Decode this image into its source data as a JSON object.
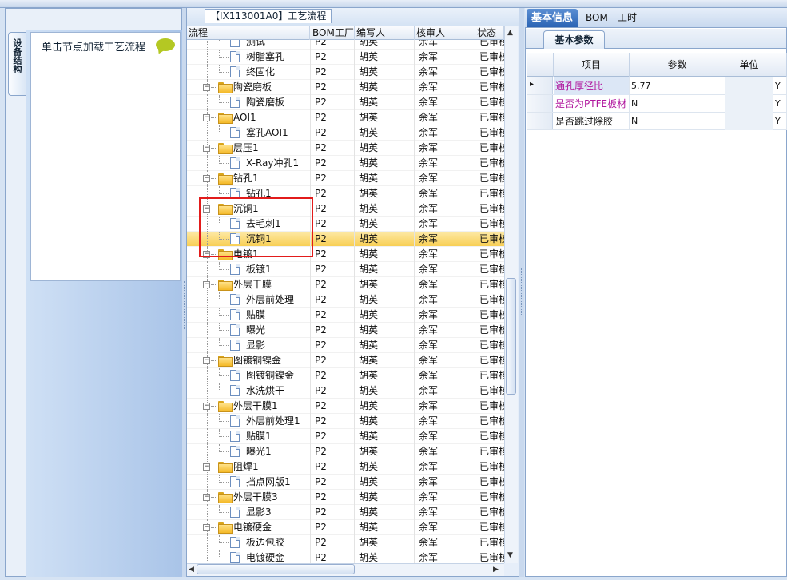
{
  "left_panel": {
    "vertical_tab": "设备结构",
    "hint": "单击节点加载工艺流程"
  },
  "center": {
    "title": "【IX113001A0】工艺流程",
    "columns": [
      "流程",
      "BOM工厂",
      "编写人",
      "核审人",
      "状态"
    ],
    "rows": [
      {
        "name": "测试",
        "type": "doc",
        "level": 2,
        "bom": "P2",
        "writer": "胡英",
        "reviewer": "余军",
        "status": "已审核"
      },
      {
        "name": "树脂塞孔",
        "type": "doc",
        "level": 2,
        "bom": "P2",
        "writer": "胡英",
        "reviewer": "余军",
        "status": "已审核"
      },
      {
        "name": "终固化",
        "type": "doc",
        "level": 2,
        "bom": "P2",
        "writer": "胡英",
        "reviewer": "余军",
        "status": "已审核"
      },
      {
        "name": "陶瓷磨板",
        "type": "folder",
        "level": 1,
        "bom": "P2",
        "writer": "胡英",
        "reviewer": "余军",
        "status": "已审核"
      },
      {
        "name": "陶瓷磨板",
        "type": "doc",
        "level": 2,
        "bom": "P2",
        "writer": "胡英",
        "reviewer": "余军",
        "status": "已审核"
      },
      {
        "name": "AOI1",
        "type": "folder",
        "level": 1,
        "bom": "P2",
        "writer": "胡英",
        "reviewer": "余军",
        "status": "已审核"
      },
      {
        "name": "塞孔AOI1",
        "type": "doc",
        "level": 2,
        "bom": "P2",
        "writer": "胡英",
        "reviewer": "余军",
        "status": "已审核"
      },
      {
        "name": "层压1",
        "type": "folder",
        "level": 1,
        "bom": "P2",
        "writer": "胡英",
        "reviewer": "余军",
        "status": "已审核"
      },
      {
        "name": "X-Ray冲孔1",
        "type": "doc",
        "level": 2,
        "bom": "P2",
        "writer": "胡英",
        "reviewer": "余军",
        "status": "已审核"
      },
      {
        "name": "钻孔1",
        "type": "folder",
        "level": 1,
        "bom": "P2",
        "writer": "胡英",
        "reviewer": "余军",
        "status": "已审核"
      },
      {
        "name": "钻孔1",
        "type": "doc",
        "level": 2,
        "bom": "P2",
        "writer": "胡英",
        "reviewer": "余军",
        "status": "已审核"
      },
      {
        "name": "沉铜1",
        "type": "folder",
        "level": 1,
        "bom": "P2",
        "writer": "胡英",
        "reviewer": "余军",
        "status": "已审核"
      },
      {
        "name": "去毛刺1",
        "type": "doc",
        "level": 2,
        "bom": "P2",
        "writer": "胡英",
        "reviewer": "余军",
        "status": "已审核"
      },
      {
        "name": "沉铜1",
        "type": "doc",
        "level": 2,
        "bom": "P2",
        "writer": "胡英",
        "reviewer": "余军",
        "status": "已审核",
        "selected": true
      },
      {
        "name": "电镀1",
        "type": "folder",
        "level": 1,
        "bom": "P2",
        "writer": "胡英",
        "reviewer": "余军",
        "status": "已审核"
      },
      {
        "name": "板镀1",
        "type": "doc",
        "level": 2,
        "bom": "P2",
        "writer": "胡英",
        "reviewer": "余军",
        "status": "已审核"
      },
      {
        "name": "外层干膜",
        "type": "folder",
        "level": 1,
        "bom": "P2",
        "writer": "胡英",
        "reviewer": "余军",
        "status": "已审核"
      },
      {
        "name": "外层前处理",
        "type": "doc",
        "level": 2,
        "bom": "P2",
        "writer": "胡英",
        "reviewer": "余军",
        "status": "已审核"
      },
      {
        "name": "贴膜",
        "type": "doc",
        "level": 2,
        "bom": "P2",
        "writer": "胡英",
        "reviewer": "余军",
        "status": "已审核"
      },
      {
        "name": "曝光",
        "type": "doc",
        "level": 2,
        "bom": "P2",
        "writer": "胡英",
        "reviewer": "余军",
        "status": "已审核"
      },
      {
        "name": "显影",
        "type": "doc",
        "level": 2,
        "bom": "P2",
        "writer": "胡英",
        "reviewer": "余军",
        "status": "已审核"
      },
      {
        "name": "图镀铜镍金",
        "type": "folder",
        "level": 1,
        "bom": "P2",
        "writer": "胡英",
        "reviewer": "余军",
        "status": "已审核"
      },
      {
        "name": "图镀铜镍金",
        "type": "doc",
        "level": 2,
        "bom": "P2",
        "writer": "胡英",
        "reviewer": "余军",
        "status": "已审核"
      },
      {
        "name": "水洗烘干",
        "type": "doc",
        "level": 2,
        "bom": "P2",
        "writer": "胡英",
        "reviewer": "余军",
        "status": "已审核"
      },
      {
        "name": "外层干膜1",
        "type": "folder",
        "level": 1,
        "bom": "P2",
        "writer": "胡英",
        "reviewer": "余军",
        "status": "已审核"
      },
      {
        "name": "外层前处理1",
        "type": "doc",
        "level": 2,
        "bom": "P2",
        "writer": "胡英",
        "reviewer": "余军",
        "status": "已审核"
      },
      {
        "name": "贴膜1",
        "type": "doc",
        "level": 2,
        "bom": "P2",
        "writer": "胡英",
        "reviewer": "余军",
        "status": "已审核"
      },
      {
        "name": "曝光1",
        "type": "doc",
        "level": 2,
        "bom": "P2",
        "writer": "胡英",
        "reviewer": "余军",
        "status": "已审核"
      },
      {
        "name": "阻焊1",
        "type": "folder",
        "level": 1,
        "bom": "P2",
        "writer": "胡英",
        "reviewer": "余军",
        "status": "已审核"
      },
      {
        "name": "挡点网版1",
        "type": "doc",
        "level": 2,
        "bom": "P2",
        "writer": "胡英",
        "reviewer": "余军",
        "status": "已审核"
      },
      {
        "name": "外层干膜3",
        "type": "folder",
        "level": 1,
        "bom": "P2",
        "writer": "胡英",
        "reviewer": "余军",
        "status": "已审核"
      },
      {
        "name": "显影3",
        "type": "doc",
        "level": 2,
        "bom": "P2",
        "writer": "胡英",
        "reviewer": "余军",
        "status": "已审核"
      },
      {
        "name": "电镀硬金",
        "type": "folder",
        "level": 1,
        "bom": "P2",
        "writer": "胡英",
        "reviewer": "余军",
        "status": "已审核"
      },
      {
        "name": "板边包胶",
        "type": "doc",
        "level": 2,
        "bom": "P2",
        "writer": "胡英",
        "reviewer": "余军",
        "status": "已审核"
      },
      {
        "name": "电镀硬金",
        "type": "doc",
        "level": 2,
        "bom": "P2",
        "writer": "胡英",
        "reviewer": "余军",
        "status": "已审核"
      }
    ]
  },
  "right": {
    "tabs": [
      "基本信息",
      "BOM",
      "工时"
    ],
    "subtab": "基本参数",
    "columns": [
      "项目",
      "参数",
      "单位"
    ],
    "rows": [
      {
        "item": "通孔厚径比",
        "value": "5.77",
        "unit": "",
        "flag": "Y",
        "item_color": "#b0179e",
        "current": true
      },
      {
        "item": "是否为PTFE板材",
        "value": "N",
        "unit": "",
        "flag": "Y",
        "item_color": "#b0179e"
      },
      {
        "item": "是否跳过除胶",
        "value": "N",
        "unit": "",
        "flag": "Y",
        "item_color": "#111111"
      }
    ]
  }
}
